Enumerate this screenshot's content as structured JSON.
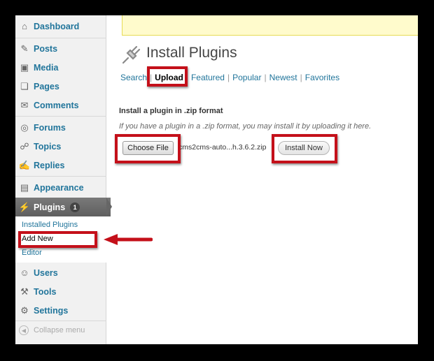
{
  "sidebar": {
    "items": [
      {
        "label": "Dashboard",
        "icon": "dashboard-icon",
        "glyph": "⌂"
      },
      {
        "label": "Posts",
        "icon": "pushpin-icon",
        "glyph": "✎"
      },
      {
        "label": "Media",
        "icon": "media-icon",
        "glyph": "▣"
      },
      {
        "label": "Pages",
        "icon": "pages-icon",
        "glyph": "❏"
      },
      {
        "label": "Comments",
        "icon": "comment-icon",
        "glyph": "✉"
      },
      {
        "label": "Forums",
        "icon": "forums-icon",
        "glyph": "◎"
      },
      {
        "label": "Topics",
        "icon": "topics-icon",
        "glyph": "☍"
      },
      {
        "label": "Replies",
        "icon": "replies-icon",
        "glyph": "✍"
      },
      {
        "label": "Appearance",
        "icon": "appearance-icon",
        "glyph": "▤"
      },
      {
        "label": "Plugins",
        "icon": "plug-icon",
        "glyph": "⚡",
        "badge": "1"
      },
      {
        "label": "Users",
        "icon": "users-icon",
        "glyph": "☺"
      },
      {
        "label": "Tools",
        "icon": "tools-icon",
        "glyph": "⚒"
      },
      {
        "label": "Settings",
        "icon": "settings-icon",
        "glyph": "⚙"
      }
    ],
    "submenu": [
      "Installed Plugins",
      "Add New",
      "Editor"
    ],
    "collapse_label": "Collapse menu"
  },
  "main": {
    "title": "Install Plugins",
    "tabs": [
      "Search",
      "Upload",
      "Featured",
      "Popular",
      "Newest",
      "Favorites"
    ],
    "current_tab": "Upload",
    "upload_heading": "Install a plugin in .zip format",
    "upload_desc": "If you have a plugin in a .zip format, you may install it by uploading it here.",
    "choose_label": "Choose File",
    "file_name": "cms2cms-auto...h.3.6.2.zip",
    "install_label": "Install Now"
  },
  "colors": {
    "link": "#21759b",
    "highlight": "#c4101a",
    "notice_bg": "#fffbcc",
    "active_menu": "#6d6d6d"
  }
}
